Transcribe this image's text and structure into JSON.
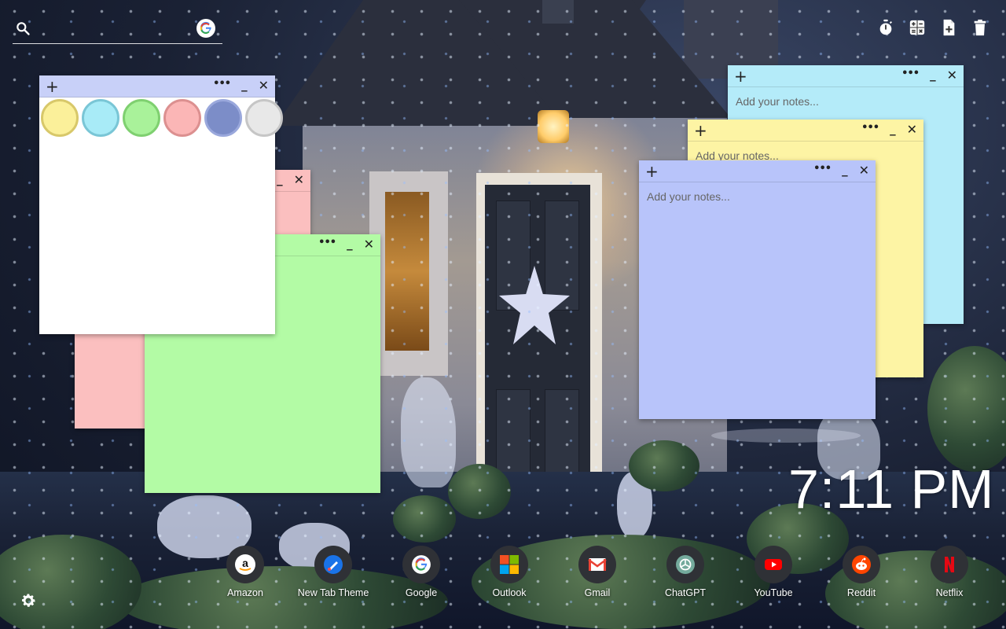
{
  "search": {
    "placeholder": "",
    "engine_icon": "google-icon"
  },
  "toolbar": {
    "buttons": [
      {
        "name": "timer-button",
        "icon": "stopwatch-icon"
      },
      {
        "name": "calculator-button",
        "icon": "calculator-icon"
      },
      {
        "name": "new-note-button",
        "icon": "add-note-icon"
      },
      {
        "name": "delete-button",
        "icon": "trash-icon"
      }
    ]
  },
  "notes": [
    {
      "id": "note-blue",
      "color": "#b4ebf9",
      "placeholder": "Add your notes..."
    },
    {
      "id": "note-yellow",
      "color": "#fdf4a4",
      "placeholder": "Add your notes..."
    },
    {
      "id": "note-periwinkle",
      "color": "#b8c4fa",
      "placeholder": "Add your notes..."
    },
    {
      "id": "note-pink",
      "color": "#fbbfbf",
      "placeholder": ""
    },
    {
      "id": "note-green",
      "color": "#b3fba5",
      "placeholder": ""
    },
    {
      "id": "note-white",
      "color": "#ffffff",
      "placeholder": ""
    }
  ],
  "palette": {
    "colors": [
      {
        "fill": "#fbf09a",
        "border": "#d8c86a"
      },
      {
        "fill": "#a8ebf7",
        "border": "#7ac6d6"
      },
      {
        "fill": "#a9f29a",
        "border": "#7fd070"
      },
      {
        "fill": "#fbb6b6",
        "border": "#dc9090"
      },
      {
        "fill": "#7c8dc8",
        "border": "#9aa8dc"
      },
      {
        "fill": "#e8e8e8",
        "border": "#c6c6c6"
      }
    ]
  },
  "clock": {
    "time": "7:11 PM"
  },
  "shortcuts": [
    {
      "label": "Amazon",
      "icon": "amazon-icon"
    },
    {
      "label": "New Tab Theme",
      "icon": "new-tab-theme-icon"
    },
    {
      "label": "Google",
      "icon": "google-icon"
    },
    {
      "label": "Outlook",
      "icon": "microsoft-icon"
    },
    {
      "label": "Gmail",
      "icon": "gmail-icon"
    },
    {
      "label": "ChatGPT",
      "icon": "chatgpt-icon"
    },
    {
      "label": "YouTube",
      "icon": "youtube-icon"
    },
    {
      "label": "Reddit",
      "icon": "reddit-icon"
    },
    {
      "label": "Netflix",
      "icon": "netflix-icon"
    }
  ],
  "settings": {
    "icon": "gear-icon"
  }
}
